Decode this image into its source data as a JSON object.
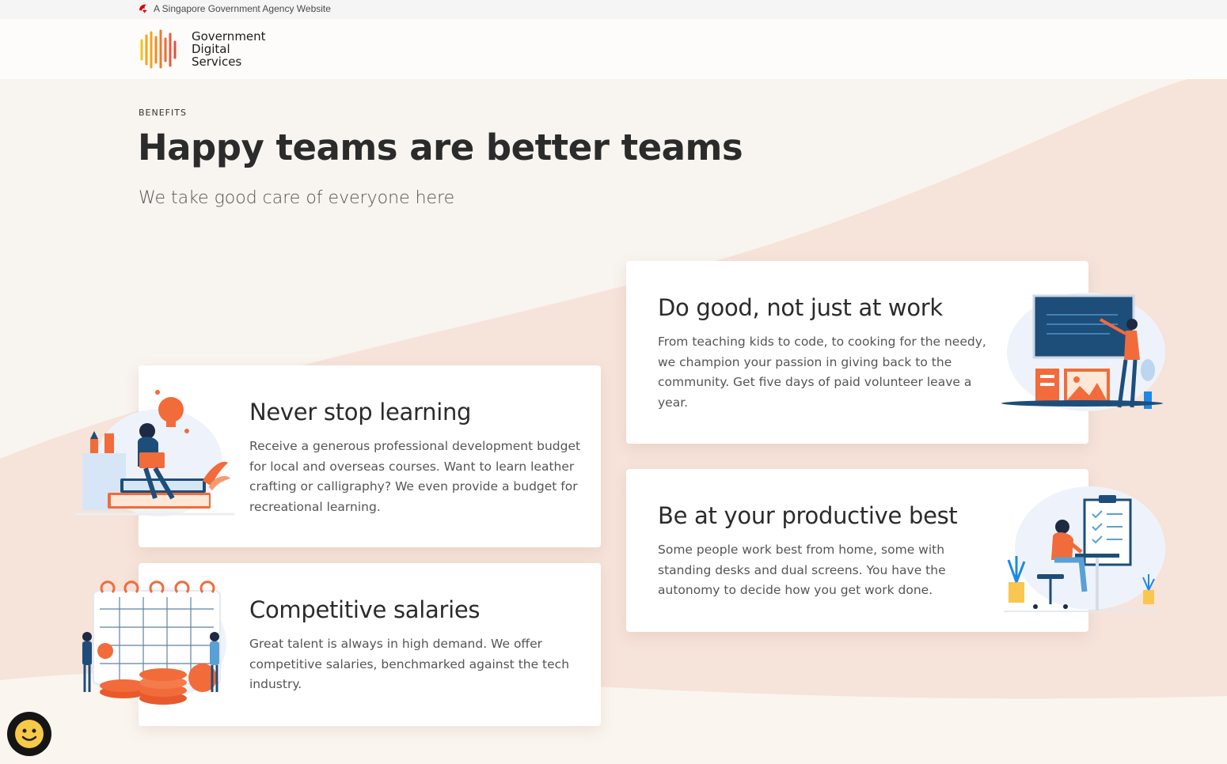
{
  "masthead": {
    "text": "A Singapore Government Agency Website",
    "icon": "lion-head-icon"
  },
  "header": {
    "logo_lines": [
      "Government",
      "Digital",
      "Services"
    ]
  },
  "section": {
    "eyebrow": "BENEFITS",
    "title": "Happy teams are better teams",
    "subtitle": "We take good care of everyone here"
  },
  "cards": [
    {
      "title": "Never stop learning",
      "body": "Receive a generous professional development budget for local and overseas courses. Want to learn leather crafting or calligraphy? We even provide a budget for recreational learning.",
      "illustration": "learning-illustration"
    },
    {
      "title": "Competitive salaries",
      "body": "Great talent is always in high demand. We offer competitive salaries, benchmarked against the tech industry.",
      "illustration": "salary-illustration"
    },
    {
      "title": "Do good, not just at work",
      "body": "From teaching kids to code, to cooking for the needy, we champion your passion in giving back to the community. Get five days of paid volunteer leave a year.",
      "illustration": "teaching-illustration"
    },
    {
      "title": "Be at your productive best",
      "body": "Some people work best from home, some with standing desks and dual screens. You have the autonomy to decide how you get work done.",
      "illustration": "productive-illustration"
    }
  ],
  "feedback": {
    "icon": "smiley-face-icon"
  },
  "colors": {
    "accent": "#f26b3a",
    "navy": "#1d4e7a",
    "background": "#f8f4ef",
    "swoosh": "#f6ddd2"
  }
}
